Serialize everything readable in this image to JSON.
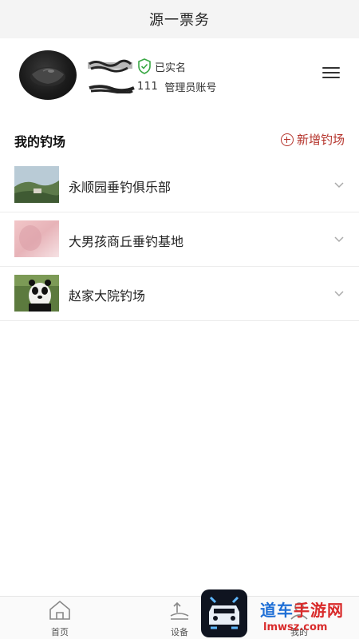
{
  "header": {
    "title": "源一票务"
  },
  "profile": {
    "verified_label": "已实名",
    "id_text": "111",
    "role_label": "管理员账号"
  },
  "section": {
    "title": "我的钓场",
    "add_label": "新增钓场"
  },
  "fishing_spots": [
    {
      "name": "永顺园垂钓俱乐部"
    },
    {
      "name": "大男孩商丘垂钓基地"
    },
    {
      "name": "赵家大院钓场"
    }
  ],
  "bottom_nav": {
    "items": [
      {
        "label": "首页",
        "icon": "home-icon"
      },
      {
        "label": "设备",
        "icon": "device-icon"
      },
      {
        "label": "我的",
        "icon": "user-icon"
      }
    ]
  },
  "watermark": {
    "text_blue": "道车",
    "text_red": "手游网",
    "url": "lmwsz.com"
  },
  "colors": {
    "accent": "#b5342c",
    "verified_green": "#3aa845",
    "top_bar_bg": "#f4f4f4"
  }
}
